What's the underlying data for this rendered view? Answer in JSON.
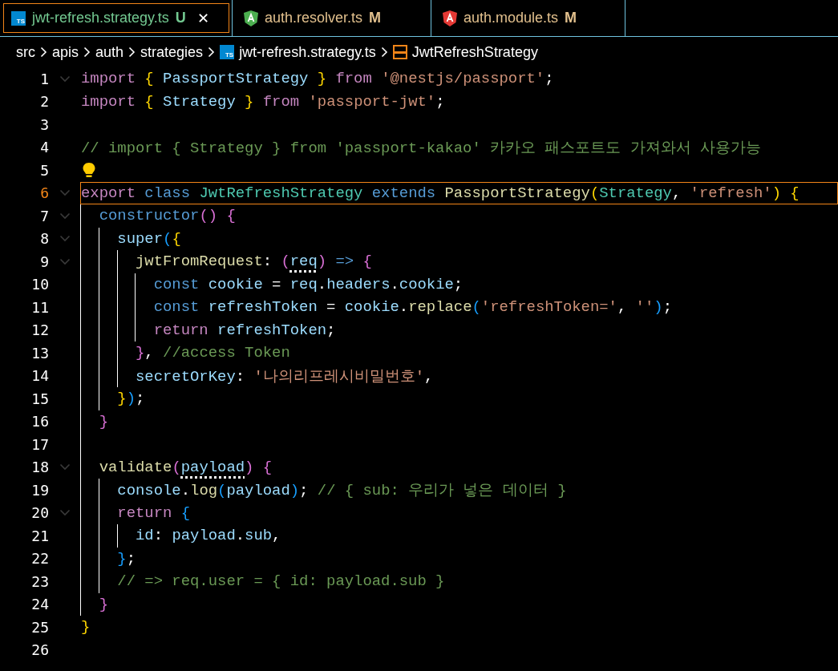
{
  "tabs": [
    {
      "label": "jwt-refresh.strategy.ts",
      "kind": "ts",
      "icon_label": "TS",
      "untracked": true,
      "status": "U",
      "selected": true,
      "close": "✕"
    },
    {
      "label": "auth.resolver.ts",
      "kind": "angular",
      "color": "#4caf50",
      "untracked": false,
      "status": "M",
      "selected": false
    },
    {
      "label": "auth.module.ts",
      "kind": "angular",
      "color": "#e53935",
      "untracked": false,
      "status": "M",
      "selected": false
    }
  ],
  "breadcrumbs": [
    {
      "kind": "folder",
      "label": "src"
    },
    {
      "kind": "folder",
      "label": "apis"
    },
    {
      "kind": "folder",
      "label": "auth"
    },
    {
      "kind": "folder",
      "label": "strategies"
    },
    {
      "kind": "file",
      "label": "jwt-refresh.strategy.ts",
      "icon_label": "TS"
    },
    {
      "kind": "symbol",
      "label": "JwtRefreshStrategy"
    }
  ],
  "editor": {
    "lines": [
      {
        "number": "1",
        "foldable": true,
        "current": false,
        "lightbulb": false,
        "tokens": [
          {
            "kind": "kw",
            "text": "import "
          },
          {
            "kind": "b1",
            "text": "{"
          },
          {
            "kind": "var",
            "text": " PassportStrategy "
          },
          {
            "kind": "b1",
            "text": "}"
          },
          {
            "kind": "kw",
            "text": " from "
          },
          {
            "kind": "str",
            "text": "'@nestjs/passport'"
          },
          {
            "kind": "punct",
            "text": ";"
          }
        ]
      },
      {
        "number": "2",
        "foldable": false,
        "current": false,
        "lightbulb": false,
        "tokens": [
          {
            "kind": "kw",
            "text": "import "
          },
          {
            "kind": "b1",
            "text": "{"
          },
          {
            "kind": "var",
            "text": " Strategy "
          },
          {
            "kind": "b1",
            "text": "}"
          },
          {
            "kind": "kw",
            "text": " from "
          },
          {
            "kind": "str",
            "text": "'passport-jwt'"
          },
          {
            "kind": "punct",
            "text": ";"
          }
        ]
      },
      {
        "number": "3",
        "foldable": false,
        "current": false,
        "lightbulb": false
      },
      {
        "number": "4",
        "foldable": false,
        "current": false,
        "lightbulb": false,
        "tokens": [
          {
            "kind": "comment",
            "text": "// import { Strategy } from 'passport-kakao' 카카오 패스포트도 가져와서 사용가능"
          }
        ]
      },
      {
        "number": "5",
        "foldable": false,
        "current": false,
        "lightbulb": true
      },
      {
        "number": "6",
        "foldable": true,
        "current": true,
        "lightbulb": false,
        "tokens": [
          {
            "kind": "kw",
            "text": "export "
          },
          {
            "kind": "storage",
            "text": "class "
          },
          {
            "kind": "type",
            "text": "JwtRefreshStrategy "
          },
          {
            "kind": "storage",
            "text": "extends "
          },
          {
            "kind": "fn",
            "text": "PassportStrategy"
          },
          {
            "kind": "b1",
            "text": "("
          },
          {
            "kind": "type",
            "text": "Strategy"
          },
          {
            "kind": "punct",
            "text": ", "
          },
          {
            "kind": "str",
            "text": "'refresh'"
          },
          {
            "kind": "b1",
            "text": ")"
          },
          {
            "kind": "b1",
            "text": " {"
          }
        ]
      },
      {
        "number": "7",
        "foldable": true,
        "current": false,
        "lightbulb": false,
        "tokens": [
          {
            "kind": "storage",
            "text": "  constructor"
          },
          {
            "kind": "b2",
            "text": "()"
          },
          {
            "kind": "b2",
            "text": " {"
          }
        ]
      },
      {
        "number": "8",
        "foldable": true,
        "current": false,
        "lightbulb": false,
        "tokens": [
          {
            "kind": "var",
            "text": "    super"
          },
          {
            "kind": "b3",
            "text": "("
          },
          {
            "kind": "b1",
            "text": "{"
          }
        ]
      },
      {
        "number": "9",
        "foldable": true,
        "current": false,
        "lightbulb": false,
        "tokens": [
          {
            "kind": "fn",
            "text": "      jwtFromRequest"
          },
          {
            "kind": "punct",
            "text": ": "
          },
          {
            "kind": "b2",
            "text": "("
          },
          {
            "kind": "var",
            "text": "req",
            "hint": true
          },
          {
            "kind": "b2",
            "text": ")"
          },
          {
            "kind": "storage",
            "text": " =>"
          },
          {
            "kind": "b2",
            "text": " {"
          }
        ]
      },
      {
        "number": "10",
        "foldable": false,
        "current": false,
        "lightbulb": false,
        "tokens": [
          {
            "kind": "storage",
            "text": "        const "
          },
          {
            "kind": "var",
            "text": "cookie"
          },
          {
            "kind": "punct",
            "text": " = "
          },
          {
            "kind": "var",
            "text": "req"
          },
          {
            "kind": "punct",
            "text": "."
          },
          {
            "kind": "var",
            "text": "headers"
          },
          {
            "kind": "punct",
            "text": "."
          },
          {
            "kind": "var",
            "text": "cookie"
          },
          {
            "kind": "punct",
            "text": ";"
          }
        ]
      },
      {
        "number": "11",
        "foldable": false,
        "current": false,
        "lightbulb": false,
        "tokens": [
          {
            "kind": "storage",
            "text": "        const "
          },
          {
            "kind": "var",
            "text": "refreshToken"
          },
          {
            "kind": "punct",
            "text": " = "
          },
          {
            "kind": "var",
            "text": "cookie"
          },
          {
            "kind": "punct",
            "text": "."
          },
          {
            "kind": "fn",
            "text": "replace"
          },
          {
            "kind": "b3",
            "text": "("
          },
          {
            "kind": "str",
            "text": "'refreshToken='"
          },
          {
            "kind": "punct",
            "text": ", "
          },
          {
            "kind": "str",
            "text": "''"
          },
          {
            "kind": "b3",
            "text": ")"
          },
          {
            "kind": "punct",
            "text": ";"
          }
        ]
      },
      {
        "number": "12",
        "foldable": false,
        "current": false,
        "lightbulb": false,
        "tokens": [
          {
            "kind": "kw",
            "text": "        return "
          },
          {
            "kind": "var",
            "text": "refreshToken"
          },
          {
            "kind": "punct",
            "text": ";"
          }
        ]
      },
      {
        "number": "13",
        "foldable": false,
        "current": false,
        "lightbulb": false,
        "tokens": [
          {
            "kind": "b2",
            "text": "      }"
          },
          {
            "kind": "punct",
            "text": ", "
          },
          {
            "kind": "comment",
            "text": "//access Token"
          }
        ]
      },
      {
        "number": "14",
        "foldable": false,
        "current": false,
        "lightbulb": false,
        "tokens": [
          {
            "kind": "var",
            "text": "      secretOrKey"
          },
          {
            "kind": "punct",
            "text": ": "
          },
          {
            "kind": "str",
            "text": "'나의리프레시비밀번호'"
          },
          {
            "kind": "punct",
            "text": ","
          }
        ]
      },
      {
        "number": "15",
        "foldable": false,
        "current": false,
        "lightbulb": false,
        "tokens": [
          {
            "kind": "b1",
            "text": "    }"
          },
          {
            "kind": "b3",
            "text": ")"
          },
          {
            "kind": "punct",
            "text": ";"
          }
        ]
      },
      {
        "number": "16",
        "foldable": false,
        "current": false,
        "lightbulb": false,
        "tokens": [
          {
            "kind": "b2",
            "text": "  }"
          }
        ]
      },
      {
        "number": "17",
        "foldable": false,
        "current": false,
        "lightbulb": false
      },
      {
        "number": "18",
        "foldable": true,
        "current": false,
        "lightbulb": false,
        "tokens": [
          {
            "kind": "fn",
            "text": "  validate"
          },
          {
            "kind": "b2",
            "text": "("
          },
          {
            "kind": "var",
            "text": "payload",
            "hint": true
          },
          {
            "kind": "b2",
            "text": ")"
          },
          {
            "kind": "b2",
            "text": " {"
          }
        ]
      },
      {
        "number": "19",
        "foldable": false,
        "current": false,
        "lightbulb": false,
        "tokens": [
          {
            "kind": "var",
            "text": "    console"
          },
          {
            "kind": "punct",
            "text": "."
          },
          {
            "kind": "fn",
            "text": "log"
          },
          {
            "kind": "b3",
            "text": "("
          },
          {
            "kind": "var",
            "text": "payload"
          },
          {
            "kind": "b3",
            "text": ")"
          },
          {
            "kind": "punct",
            "text": "; "
          },
          {
            "kind": "comment",
            "text": "// { sub: 우리가 넣은 데이터 }"
          }
        ]
      },
      {
        "number": "20",
        "foldable": true,
        "current": false,
        "lightbulb": false,
        "tokens": [
          {
            "kind": "kw",
            "text": "    return "
          },
          {
            "kind": "b3",
            "text": "{"
          }
        ]
      },
      {
        "number": "21",
        "foldable": false,
        "current": false,
        "lightbulb": false,
        "tokens": [
          {
            "kind": "var",
            "text": "      id"
          },
          {
            "kind": "punct",
            "text": ": "
          },
          {
            "kind": "var",
            "text": "payload"
          },
          {
            "kind": "punct",
            "text": "."
          },
          {
            "kind": "var",
            "text": "sub"
          },
          {
            "kind": "punct",
            "text": ","
          }
        ]
      },
      {
        "number": "22",
        "foldable": false,
        "current": false,
        "lightbulb": false,
        "tokens": [
          {
            "kind": "b3",
            "text": "    }"
          },
          {
            "kind": "punct",
            "text": ";"
          }
        ]
      },
      {
        "number": "23",
        "foldable": false,
        "current": false,
        "lightbulb": false,
        "tokens": [
          {
            "kind": "comment",
            "text": "    // => req.user = { id: payload.sub }"
          }
        ]
      },
      {
        "number": "24",
        "foldable": false,
        "current": false,
        "lightbulb": false,
        "tokens": [
          {
            "kind": "b2",
            "text": "  }"
          }
        ]
      },
      {
        "number": "25",
        "foldable": false,
        "current": false,
        "lightbulb": false,
        "tokens": [
          {
            "kind": "b1",
            "text": "}"
          }
        ]
      },
      {
        "number": "26",
        "foldable": false,
        "current": false,
        "lightbulb": false
      }
    ]
  }
}
